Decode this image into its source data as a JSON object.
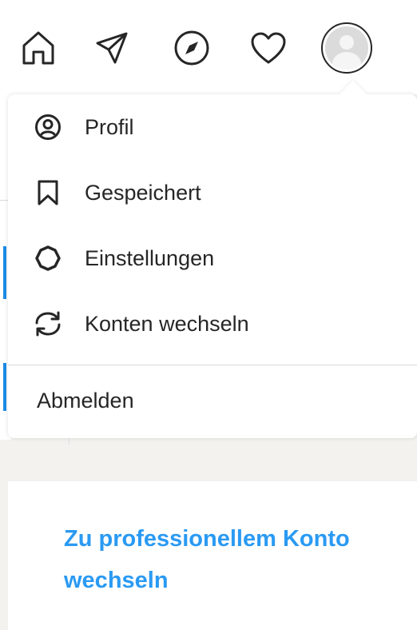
{
  "navbar": {
    "icons": {
      "home": "home-icon",
      "direct": "paper-plane-icon",
      "explore": "compass-icon",
      "activity": "heart-icon",
      "profile": "avatar"
    }
  },
  "dropdown": {
    "items": [
      {
        "label": "Profil",
        "icon": "user-circle-icon"
      },
      {
        "label": "Gespeichert",
        "icon": "bookmark-icon"
      },
      {
        "label": "Einstellungen",
        "icon": "settings-gear-icon"
      },
      {
        "label": "Konten wechseln",
        "icon": "switch-accounts-icon"
      }
    ],
    "logout_label": "Abmelden"
  },
  "pro_card": {
    "link_text": "Zu professionellem Konto wechseln"
  },
  "colors": {
    "accent_blue": "#2a9af3",
    "text": "#262626",
    "divider": "#dbdbdb",
    "page_background": "#f3f2ef"
  }
}
